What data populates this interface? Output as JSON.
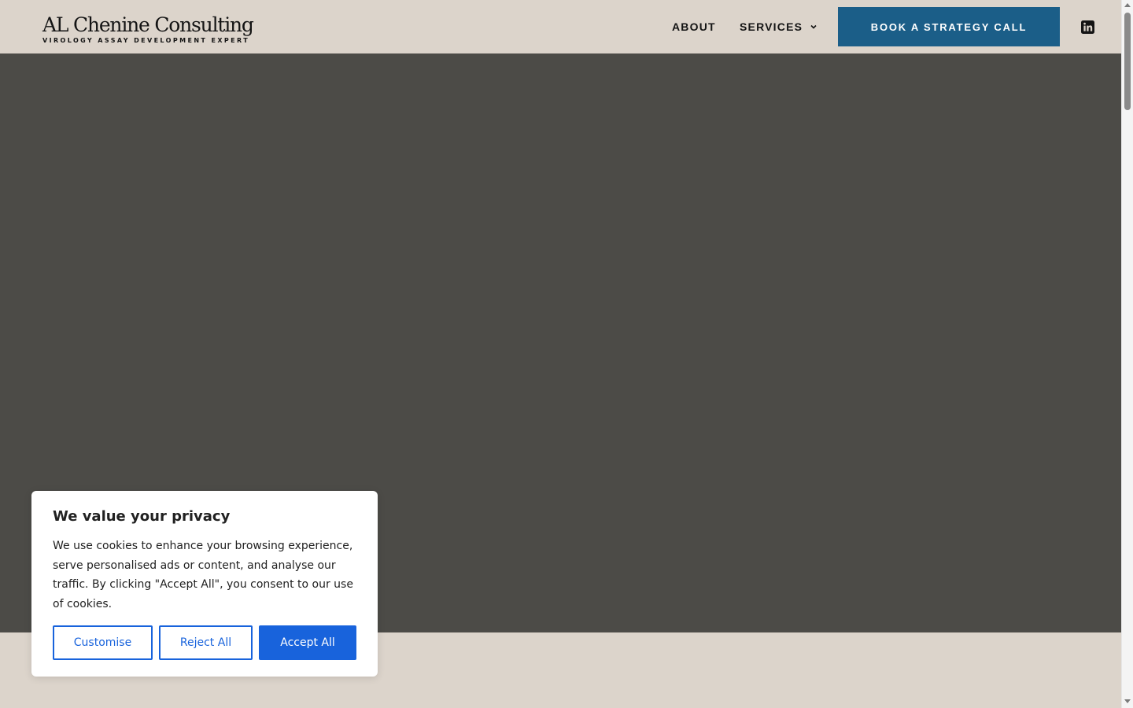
{
  "header": {
    "logo_title": "AL Chenine Consulting",
    "logo_tagline": "VIROLOGY ASSAY DEVELOPMENT EXPERT",
    "nav": {
      "about": "ABOUT",
      "services": "SERVICES"
    },
    "cta_label": "BOOK A STRATEGY CALL",
    "social_icon": "linkedin-icon"
  },
  "cookie_banner": {
    "title": "We value your privacy",
    "body": "We use cookies to enhance your browsing experience, serve personalised ads or content, and analyse our traffic. By clicking \"Accept All\", you consent to our use of cookies.",
    "customise_label": "Customise",
    "reject_label": "Reject All",
    "accept_label": "Accept All"
  },
  "colors": {
    "header_bg": "#dcd4cb",
    "hero_bg": "#4c4b47",
    "cta_bg": "#1b5e88",
    "cookie_accent": "#1863dc",
    "text_dark": "#141414"
  }
}
